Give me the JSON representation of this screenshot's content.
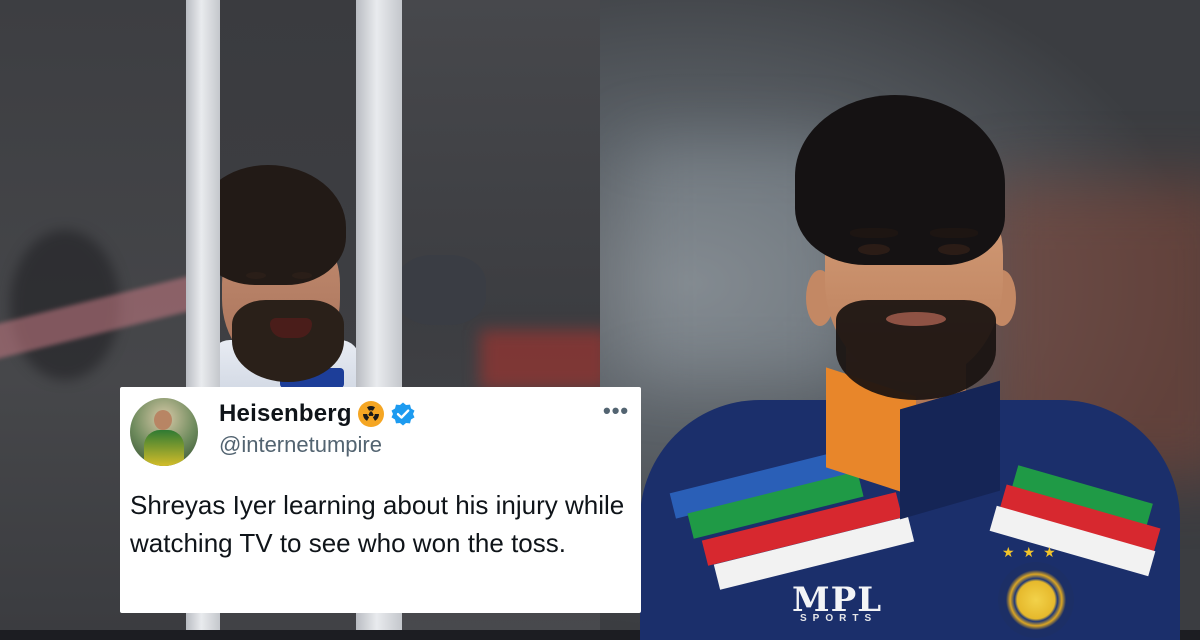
{
  "tweet": {
    "display_name": "Heisenberg",
    "handle": "@internetumpire",
    "text": "Shreyas Iyer learning about his injury while watching TV to see who won the toss.",
    "icons": [
      "avatar",
      "radioactive-icon",
      "verified-badge-icon",
      "more-options-icon"
    ]
  },
  "photo_right": {
    "jersey_logo": "MPL",
    "jersey_logo_sub": "SPORTS"
  },
  "colors": {
    "verified_blue": "#1d9bf0",
    "emoji_orange": "#f5a623",
    "text_primary": "#0f1419",
    "text_secondary": "#536471"
  }
}
